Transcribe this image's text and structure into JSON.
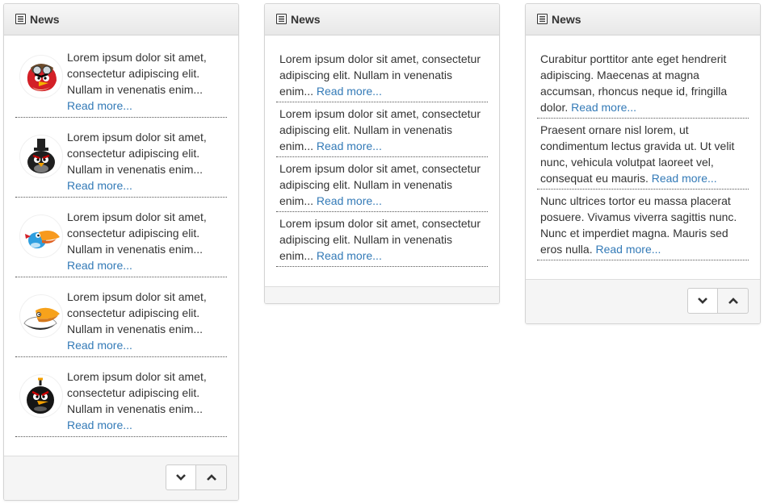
{
  "panel1": {
    "title": "News",
    "items": [
      {
        "text": "Lorem ipsum dolor sit amet, consectetur adipiscing elit. Nullam in venenatis enim...",
        "link": "Read more..."
      },
      {
        "text": "Lorem ipsum dolor sit amet, consectetur adipiscing elit. Nullam in venenatis enim...",
        "link": "Read more..."
      },
      {
        "text": "Lorem ipsum dolor sit amet, consectetur adipiscing elit. Nullam in venenatis enim...",
        "link": "Read more..."
      },
      {
        "text": "Lorem ipsum dolor sit amet, consectetur adipiscing elit. Nullam in venenatis enim...",
        "link": "Read more..."
      },
      {
        "text": "Lorem ipsum dolor sit amet, consectetur adipiscing elit. Nullam in venenatis enim...",
        "link": "Read more..."
      }
    ]
  },
  "panel2": {
    "title": "News",
    "items": [
      {
        "text": "Lorem ipsum dolor sit amet, consectetur adipiscing elit. Nullam in venenatis enim...",
        "link": "Read more..."
      },
      {
        "text": "Lorem ipsum dolor sit amet, consectetur adipiscing elit. Nullam in venenatis enim...",
        "link": "Read more..."
      },
      {
        "text": "Lorem ipsum dolor sit amet, consectetur adipiscing elit. Nullam in venenatis enim...",
        "link": "Read more..."
      },
      {
        "text": "Lorem ipsum dolor sit amet, consectetur adipiscing elit. Nullam in venenatis enim...",
        "link": "Read more..."
      }
    ]
  },
  "panel3": {
    "title": "News",
    "items": [
      {
        "text": "Curabitur porttitor ante eget hendrerit adipiscing. Maecenas at magna accumsan, rhoncus neque id, fringilla dolor.",
        "link": "Read more..."
      },
      {
        "text": "Praesent ornare nisl lorem, ut condimentum lectus gravida ut. Ut velit nunc, vehicula volutpat laoreet vel, consequat eu mauris.",
        "link": "Read more..."
      },
      {
        "text": "Nunc ultrices tortor eu massa placerat posuere. Vivamus viverra sagittis nunc. Nunc et imperdiet magna. Mauris sed eros nulla.",
        "link": "Read more..."
      }
    ]
  },
  "icons": {
    "heading": "list-alt-icon",
    "down": "chevron-down-icon",
    "up": "chevron-up-icon",
    "avatars": [
      "red-pilot-bird-icon",
      "black-hat-bird-icon",
      "blue-toucan-bird-icon",
      "white-egg-bird-icon",
      "black-bomb-bird-icon"
    ]
  },
  "colors": {
    "link": "#337ab7",
    "text": "#333333"
  }
}
